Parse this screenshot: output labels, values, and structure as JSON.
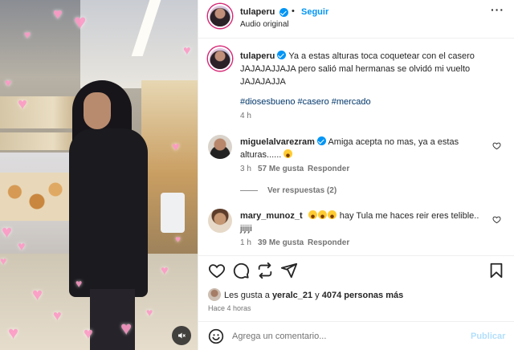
{
  "post": {
    "username": "tulaperu",
    "follow_label": "Seguir",
    "dot": "•",
    "audio": "Audio original",
    "more_icon": "more-horizontal-icon"
  },
  "caption": {
    "username": "tulaperu",
    "text": "Ya a estas alturas toca coquetear con el casero JAJAJAJJAJA pero salió mal hermanas se olvidó mi vuelto JAJAJAJJA",
    "hashtags": "#diosesbueno #casero #mercado",
    "time": "4 h"
  },
  "comments": [
    {
      "username": "miguelalvarezram",
      "verified": true,
      "text": "Amiga acepta no mas, ya a estas alturas......",
      "time": "3 h",
      "likes": "57 Me gusta",
      "reply_label": "Responder",
      "view_replies": "Ver respuestas (2)"
    },
    {
      "username": "mary_munoz_t",
      "verified": false,
      "text": "hay Tula me haces reir eres telible.. jijiji",
      "time": "1 h",
      "likes": "39 Me gusta",
      "reply_label": "Responder"
    }
  ],
  "likes": {
    "prefix": "Les gusta a",
    "user": "yeralc_21",
    "connector": "y",
    "count": "4074 personas más"
  },
  "posted_ago": "Hace 4 horas",
  "composer": {
    "placeholder": "Agrega un comentario...",
    "publish_label": "Publicar",
    "emoji_icon": "smiley-icon"
  },
  "colors": {
    "accent": "#0095f6",
    "text": "#262626",
    "muted": "#737373",
    "hashtag": "#00376b",
    "publish_disabled": "#b2dffc"
  }
}
